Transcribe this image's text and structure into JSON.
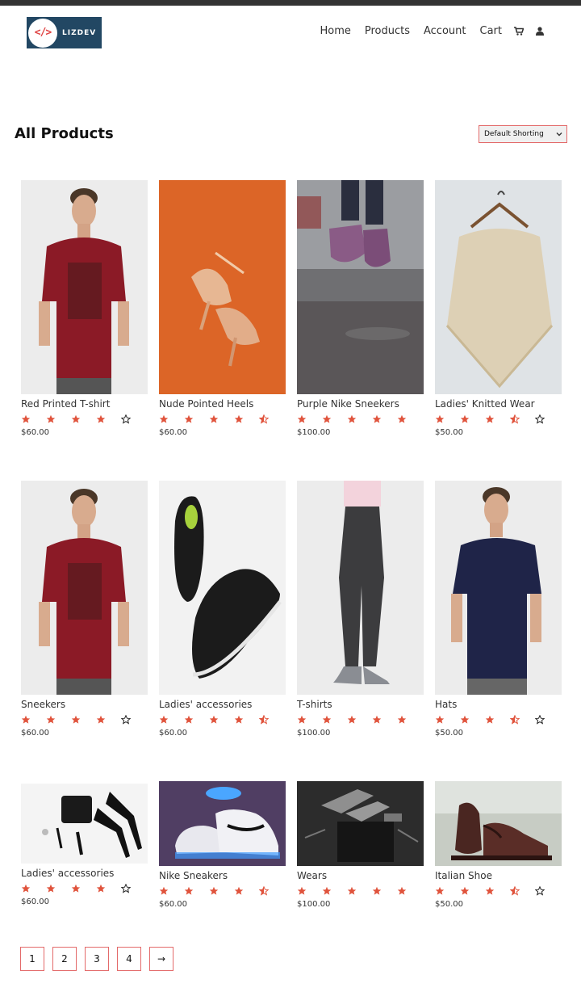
{
  "brand": {
    "logo_code": "</>",
    "name": "LIZDEV"
  },
  "nav": {
    "items": [
      "Home",
      "Products",
      "Account",
      "Cart"
    ],
    "icons": [
      "cart-icon",
      "user-icon"
    ]
  },
  "main": {
    "title": "All Products",
    "sort_value": "Default Shorting"
  },
  "colors": {
    "accent": "#e0533c",
    "border": "#e36a6a",
    "logo_bg": "#224763"
  },
  "products": [
    {
      "name": "Red Printed T-shirt",
      "price": "$60.00",
      "rating": 4
    },
    {
      "name": "Nude Pointed Heels",
      "price": "$60.00",
      "rating": 4.5
    },
    {
      "name": "Purple Nike Sneekers",
      "price": "$100.00",
      "rating": 5
    },
    {
      "name": "Ladies' Knitted Wear",
      "price": "$50.00",
      "rating": 3.5
    },
    {
      "name": "Sneekers",
      "price": "$60.00",
      "rating": 4
    },
    {
      "name": "Ladies' accessories",
      "price": "$60.00",
      "rating": 4.5
    },
    {
      "name": "T-shirts",
      "price": "$100.00",
      "rating": 5
    },
    {
      "name": "Hats",
      "price": "$50.00",
      "rating": 3.5
    },
    {
      "name": "Ladies' accessories",
      "price": "$60.00",
      "rating": 4
    },
    {
      "name": "Nike Sneakers",
      "price": "$60.00",
      "rating": 4.5
    },
    {
      "name": "Wears",
      "price": "$100.00",
      "rating": 5
    },
    {
      "name": "Italian Shoe",
      "price": "$50.00",
      "rating": 3.5
    }
  ],
  "pagination": [
    "1",
    "2",
    "3",
    "4",
    "→"
  ]
}
